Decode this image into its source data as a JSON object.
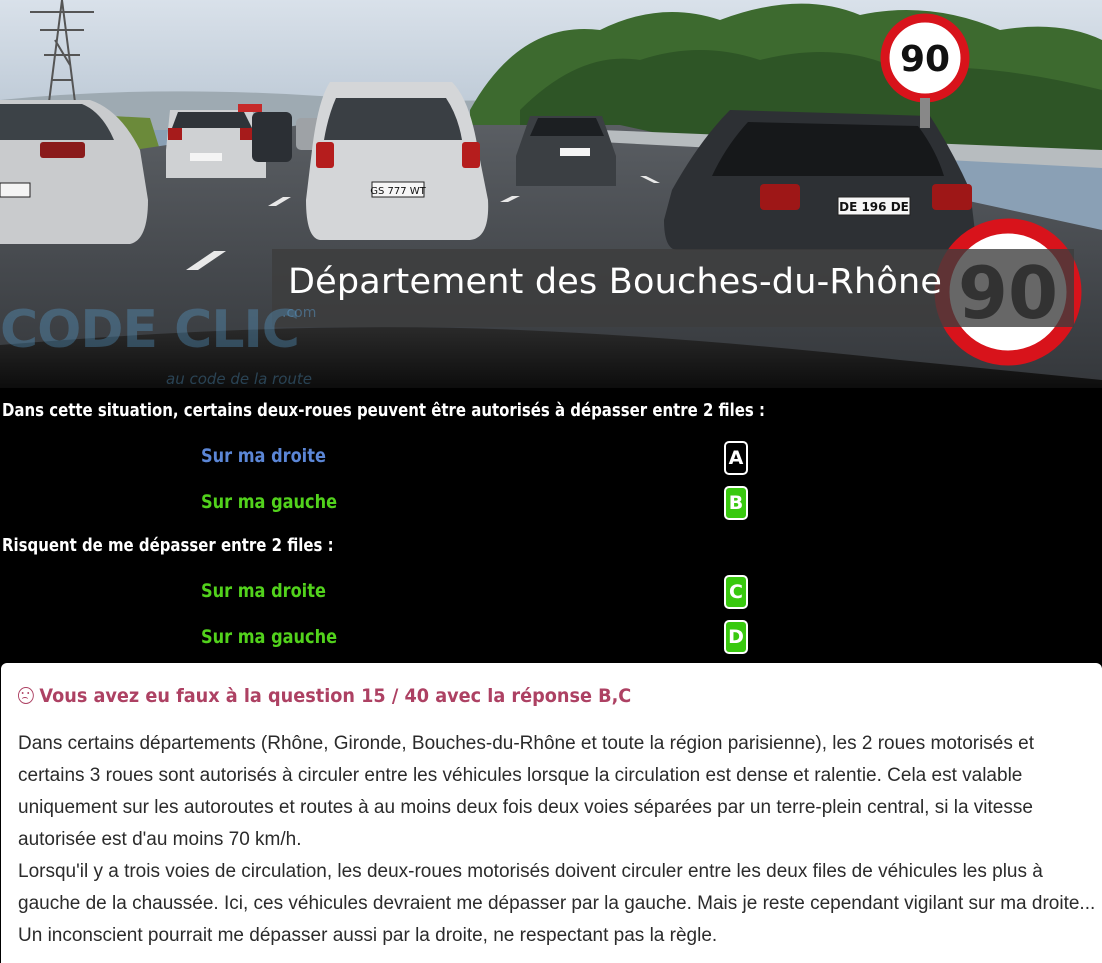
{
  "scene": {
    "banner_text": "Département des Bouches-du-Rhône",
    "speed_limit": "90",
    "watermark": "CODE CLIC",
    "watermark_sub": "au code de la route",
    "watermark_domain": ".com",
    "plates": [
      "DE 196 DE",
      "GS 777 WT"
    ]
  },
  "questions": [
    {
      "text": "Dans cette situation, certains deux-roues peuvent être autorisés à dépasser entre 2 files :",
      "answers": [
        {
          "label": "Sur ma droite",
          "letter": "A",
          "state": "unselected"
        },
        {
          "label": "Sur ma gauche",
          "letter": "B",
          "state": "selected"
        }
      ]
    },
    {
      "text": "Risquent de me dépasser entre 2 files :",
      "answers": [
        {
          "label": "Sur ma droite",
          "letter": "C",
          "state": "selected"
        },
        {
          "label": "Sur ma gauche",
          "letter": "D",
          "state": "selected"
        }
      ]
    }
  ],
  "result": {
    "icon": "frown-icon",
    "text": "Vous avez eu faux à la question 15 / 40 avec la réponse B,C"
  },
  "explanation": {
    "p1": "Dans certains départements (Rhône, Gironde, Bouches-du-Rhône et toute la région parisienne), les 2 roues motorisés et certains 3 roues sont autorisés à circuler entre les véhicules lorsque la circulation est dense et ralentie. Cela est valable uniquement sur les autoroutes et routes à au moins deux fois deux voies séparées par un terre-plein central, si la vitesse autorisée est d'au moins 70 km/h.",
    "p2": "Lorsqu'il y a trois voies de circulation, les deux-roues motorisés doivent circuler entre les deux files de véhicules les plus à gauche de la chaussée. Ici, ces véhicules devraient me dépasser par la gauche. Mais je reste cependant vigilant sur ma droite... Un inconscient pourrait me dépasser aussi par la droite, ne respectant pas la règle."
  },
  "colors": {
    "correct_green": "#39c90f",
    "answer_blue": "#5b86d6",
    "error_red": "#ad4163",
    "sign_red": "#d8131b"
  }
}
